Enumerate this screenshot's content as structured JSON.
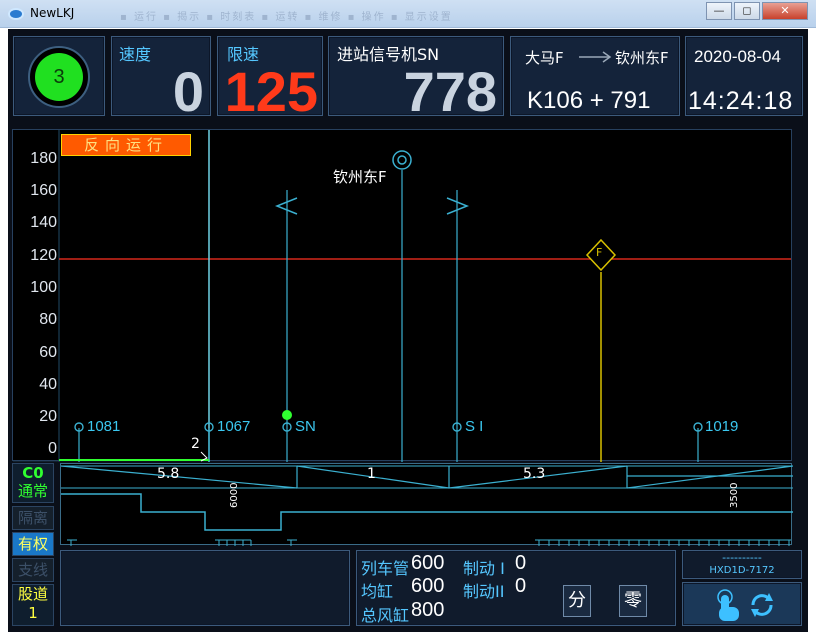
{
  "window": {
    "title": "NewLKJ",
    "menu_ghost": "▪ 运行  ▪ 揭示  ▪ 时刻表  ▪ 运转  ▪ 维修  ▪ 操作  ▪ 显示设置",
    "minimize": "—",
    "restore": "◻",
    "close": "✕"
  },
  "signal": {
    "value": "3",
    "color": "#20e020"
  },
  "speed": {
    "label": "速度",
    "value": "0"
  },
  "limit": {
    "label": "限速",
    "value": "125"
  },
  "next_signal": {
    "label": "进站信号机SN",
    "distance": "778"
  },
  "route": {
    "from": "大马F",
    "to": "钦州东F",
    "mileage": "K106 + 791"
  },
  "datetime": {
    "date": "2020-08-04",
    "time": "14:24:18"
  },
  "chart": {
    "banner": "反向运行",
    "y_ticks": [
      "180",
      "160",
      "140",
      "120",
      "100",
      "80",
      "60",
      "40",
      "20",
      "0"
    ],
    "station_name": "钦州东F",
    "markers": [
      "1081",
      "1067",
      "SN",
      "S I",
      "1019"
    ],
    "f_marker": "F",
    "train_pos": "2"
  },
  "track": {
    "gradients": [
      "5.8",
      "1",
      "5.3"
    ],
    "curve_labels": [
      "6000",
      "3500"
    ]
  },
  "side": {
    "c0": "C0",
    "normal": "通常",
    "isolate": "隔离",
    "priority": "有权",
    "branch": "支线",
    "track_label": "股道",
    "track_num": "1"
  },
  "pressures": {
    "pipe_label": "列车管",
    "pipe_value": "600",
    "brake1_label": "制动 I",
    "brake1_value": "0",
    "cylinder_label": "均缸",
    "cylinder_value": "600",
    "brake2_label": "制动II",
    "brake2_value": "0",
    "main_label": "总风缸",
    "main_value": "800",
    "fen_button": "分",
    "ling_button": "零"
  },
  "device": {
    "dashes": "----------",
    "model": "HXD1D-7172"
  },
  "colors": {
    "accent": "#55c7ff",
    "limit": "#ff3a1a",
    "line": "#3bb0d0",
    "banner": "#ff5a00"
  }
}
